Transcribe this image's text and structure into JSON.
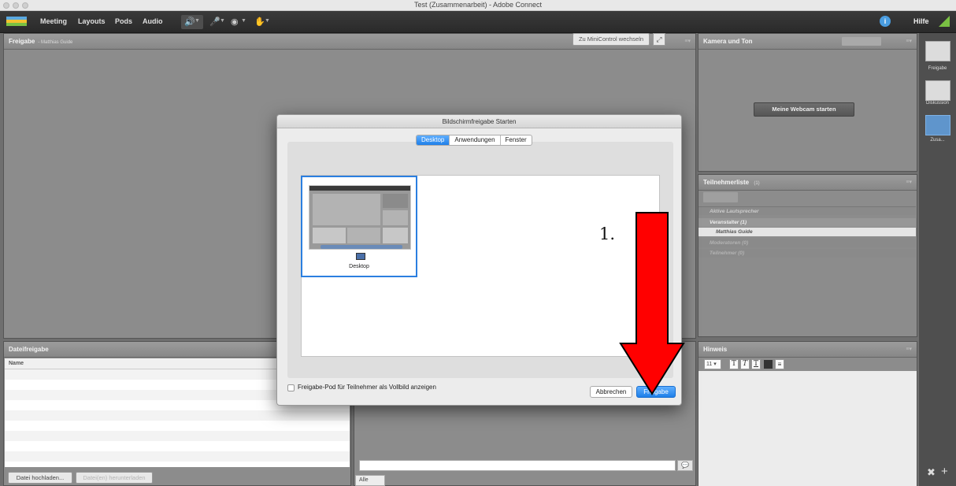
{
  "window": {
    "title": "Test (Zusammenarbeit) - Adobe Connect"
  },
  "menubar": {
    "items": [
      "Meeting",
      "Layouts",
      "Pods",
      "Audio"
    ],
    "help": "Hilfe",
    "help_icon": "info-icon"
  },
  "share_pod": {
    "title": "Freigabe",
    "subtitle": "- Matthias Guide",
    "minicontrol_label": "Zu MiniControl wechseln"
  },
  "camera_pod": {
    "title": "Kamera und Ton",
    "webcam_button": "Meine Webcam starten"
  },
  "attendees_pod": {
    "title": "Teilnehmerliste",
    "count": "(1)",
    "rows": [
      "Aktive Lautsprecher",
      "Veranstalter (1)",
      "Matthias Guide",
      "Moderatoren (0)",
      "Teilnehmer (0)"
    ]
  },
  "files_pod": {
    "title": "Dateifreigabe",
    "column_name": "Name",
    "upload_button": "Datei hochladen...",
    "download_button": "Datei(en) herunterladen"
  },
  "notes_pod": {
    "title": "Hinweis",
    "font_size": "11"
  },
  "chat_pod": {
    "tab_all": "Alle"
  },
  "sidebar": {
    "layouts": [
      "Freigabe",
      "Diskussion",
      "Zusa..."
    ]
  },
  "dialog": {
    "title": "Bildschirmfreigabe Starten",
    "tabs": [
      "Desktop",
      "Anwendungen",
      "Fenster"
    ],
    "active_tab": "Desktop",
    "thumbnail_label": "Desktop",
    "checkbox_label": "Freigabe-Pod für Teilnehmer als Vollbild anzeigen",
    "cancel_button": "Abbrechen",
    "share_button": "Freigabe"
  },
  "annotation": {
    "step_label": "1.",
    "arrow_color": "#ff0000"
  },
  "colors": {
    "accent": "#1f7fe8",
    "toolbar_green": "#7ac143"
  }
}
